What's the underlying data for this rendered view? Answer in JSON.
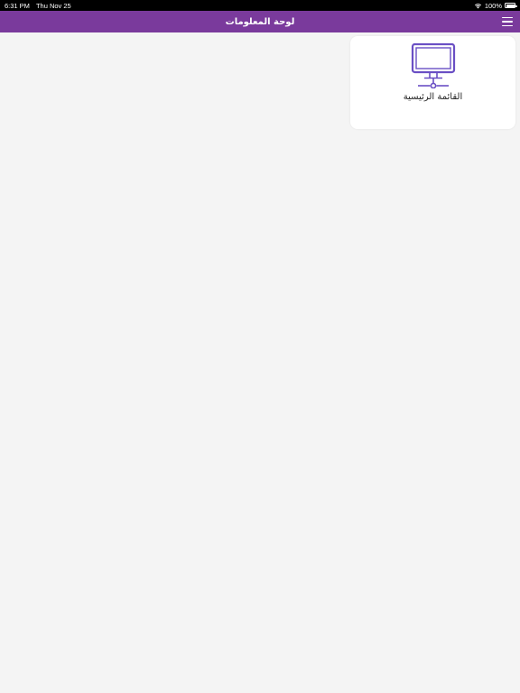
{
  "status_bar": {
    "time": "6:31 PM",
    "date": "Thu Nov 25",
    "battery": "100%",
    "wifi_icon": "wifi-icon",
    "battery_icon": "battery-icon"
  },
  "nav": {
    "title": "لوحة المعلومات",
    "menu_icon": "hamburger-menu-icon",
    "color": "#7a3a9c"
  },
  "cards": [
    {
      "label": "القائمة الرئيسية",
      "icon": "monitor-network-icon",
      "icon_color": "#6a4fc4"
    }
  ]
}
